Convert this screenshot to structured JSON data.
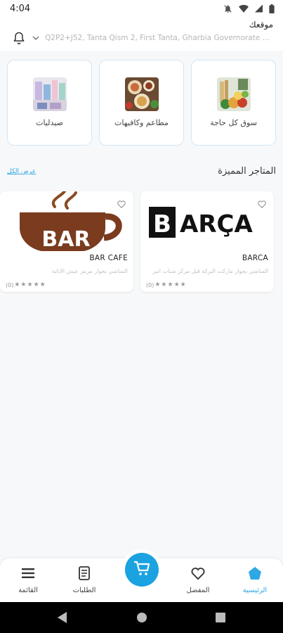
{
  "status_bar": {
    "time": "4:04"
  },
  "header": {
    "location_label": "موقعك",
    "address": "Q2P2+J52, Tanta Qism 2, First Tanta, Gharbia Governorate 6632..."
  },
  "categories": [
    {
      "label": "سوق كل حاجة"
    },
    {
      "label": "مطاعم وكافيهات"
    },
    {
      "label": "صيدليات"
    }
  ],
  "featured": {
    "title": "المتاجر المميزة",
    "see_all": "عرض الكل",
    "stores": [
      {
        "name": "BARCA",
        "logo_text": "ARÇA",
        "logo_letter": "B",
        "description": "المناشي بجوار ماركت البركة قبل مركز شباب انبر",
        "rating_count": "(0)"
      },
      {
        "name": "BAR CAFE",
        "logo_text": "BAR",
        "description": "المناشي بجوار مرمز عيش الانابة",
        "rating_count": "(0)"
      }
    ]
  },
  "bottom_nav": {
    "items": [
      {
        "label": "الرئيسية",
        "icon": "home-icon",
        "active": true
      },
      {
        "label": "المفضل",
        "icon": "heart-icon",
        "active": false
      },
      {
        "label": "الطلبات",
        "icon": "orders-icon",
        "active": false
      },
      {
        "label": "القائمة",
        "icon": "menu-icon",
        "active": false
      }
    ],
    "cart_icon": "cart-icon"
  },
  "colors": {
    "accent": "#2ea8e3",
    "fab": "#1ba2e0",
    "card_border": "#cfe7f7",
    "coffee_brown": "#7a3b1e"
  }
}
